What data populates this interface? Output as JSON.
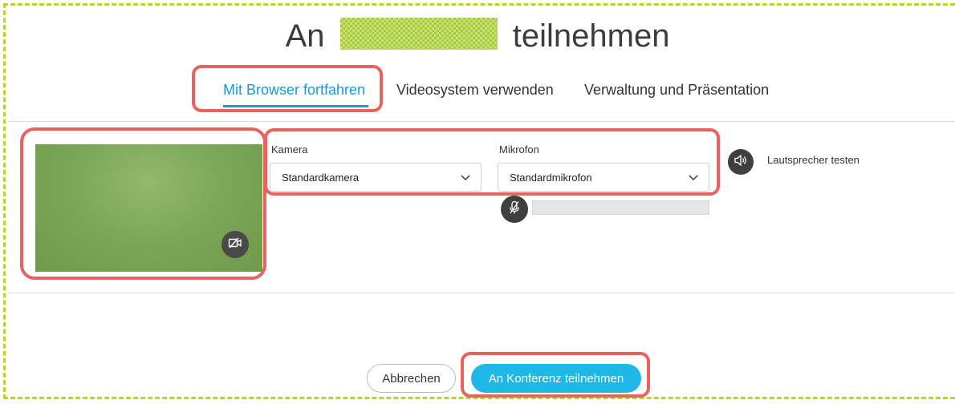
{
  "header": {
    "title_prefix": "An",
    "title_suffix": "teilnehmen"
  },
  "tabs": [
    {
      "label": "Mit Browser fortfahren",
      "active": true
    },
    {
      "label": "Videosystem verwenden",
      "active": false
    },
    {
      "label": "Verwaltung und Präsentation",
      "active": false
    }
  ],
  "media": {
    "camera_label": "Kamera",
    "camera_value": "Standardkamera",
    "microphone_label": "Mikrofon",
    "microphone_value": "Standardmikrofon",
    "mic_level": 0,
    "speaker_test_label": "Lautsprecher testen"
  },
  "actions": {
    "cancel_label": "Abbrechen",
    "join_label": "An Konferenz teilnehmen"
  },
  "colors": {
    "accent": "#1a9ad6",
    "join_button": "#1fb7e6",
    "highlight": "#e8625f",
    "frame_dashed": "#b5d334"
  },
  "icons": [
    "video-off-icon",
    "chevron-down-icon",
    "microphone-muted-icon",
    "speaker-icon"
  ]
}
